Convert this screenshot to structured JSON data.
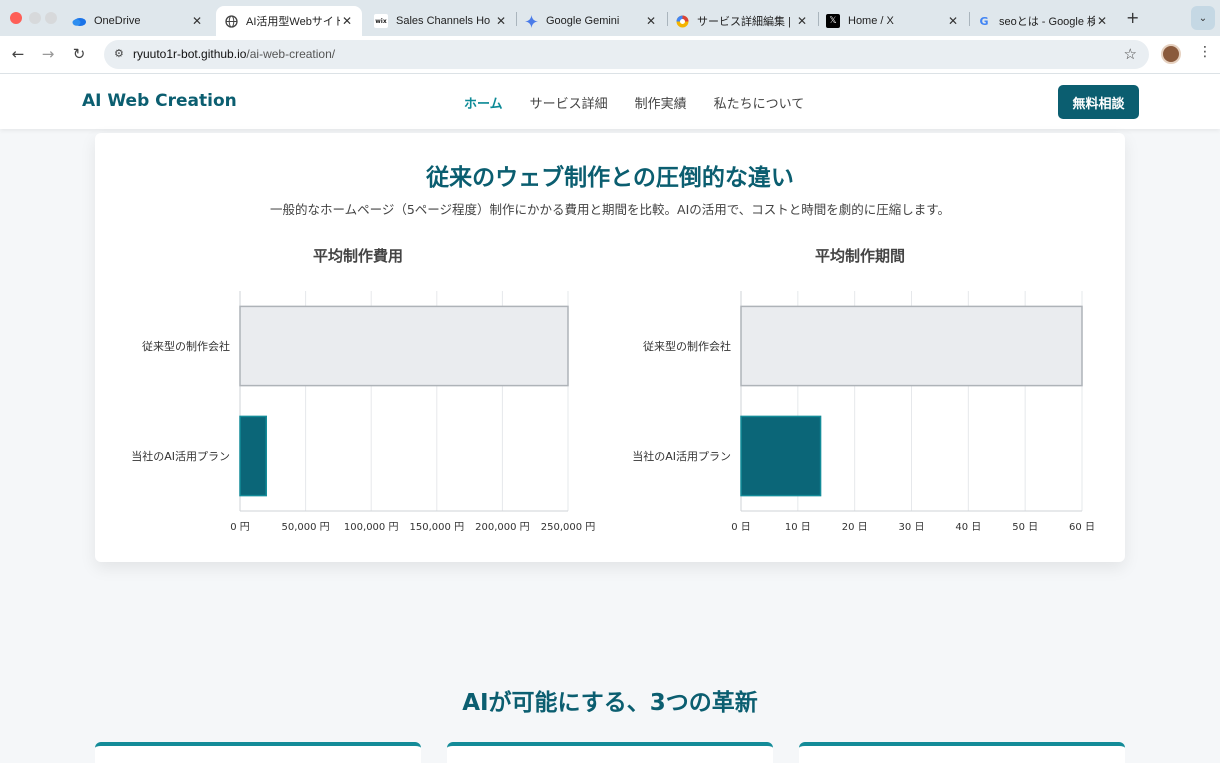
{
  "browser": {
    "tabs": [
      {
        "title": "OneDrive",
        "icon": "onedrive-icon"
      },
      {
        "title": "AI活用型Webサイト制",
        "icon": "globe-icon"
      },
      {
        "title": "Sales Channels Ho",
        "icon": "wix-icon"
      },
      {
        "title": "Google Gemini",
        "icon": "gemini-icon"
      },
      {
        "title": "サービス詳細編集 | コ",
        "icon": "service-edit-icon"
      },
      {
        "title": "Home / X",
        "icon": "x-icon"
      },
      {
        "title": "seoとは - Google 検",
        "icon": "google-icon"
      }
    ],
    "url_domain": "ryuuto1r-bot.github.io",
    "url_path": "/ai-web-creation/"
  },
  "site": {
    "logo": "AI Web Creation",
    "nav": [
      {
        "label": "ホーム",
        "active": true
      },
      {
        "label": "サービス詳細",
        "active": false
      },
      {
        "label": "制作実績",
        "active": false
      },
      {
        "label": "私たちについて",
        "active": false
      }
    ],
    "cta": "無料相談",
    "brand_color": "#0b5e70",
    "accent_color": "#138b98"
  },
  "comparison": {
    "title": "従来のウェブ制作との圧倒的な違い",
    "subtitle": "一般的なホームページ（5ページ程度）制作にかかる費用と期間を比較。AIの活用で、コストと時間を劇的に圧縮します。"
  },
  "chart_data": [
    {
      "type": "bar",
      "orientation": "horizontal",
      "title": "平均制作費用",
      "categories": [
        "従来型の制作会社",
        "当社のAI活用プラン"
      ],
      "values": [
        250000,
        20000
      ],
      "xlim": [
        0,
        250000
      ],
      "ticks": [
        "0 円",
        "50,000 円",
        "100,000 円",
        "150,000 円",
        "200,000 円",
        "250,000 円"
      ],
      "tick_values": [
        0,
        50000,
        100000,
        150000,
        200000,
        250000
      ],
      "colors": [
        "#eaecef",
        "#0b6678"
      ],
      "grid": true
    },
    {
      "type": "bar",
      "orientation": "horizontal",
      "title": "平均制作期間",
      "categories": [
        "従来型の制作会社",
        "当社のAI活用プラン"
      ],
      "values": [
        60,
        14
      ],
      "xlim": [
        0,
        60
      ],
      "ticks": [
        "0 日",
        "10 日",
        "20 日",
        "30 日",
        "40 日",
        "50 日",
        "60 日"
      ],
      "tick_values": [
        0,
        10,
        20,
        30,
        40,
        50,
        60
      ],
      "colors": [
        "#eaecef",
        "#0b6678"
      ],
      "grid": true
    }
  ],
  "innovations": {
    "title": "AIが可能にする、3つの革新"
  }
}
